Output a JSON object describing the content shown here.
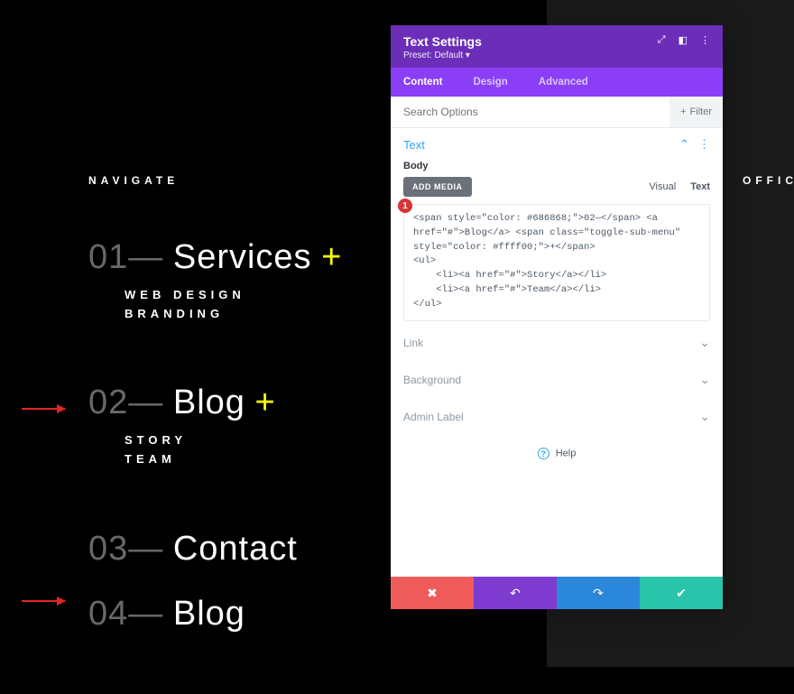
{
  "labels": {
    "navigate": "NAVIGATE",
    "office": "OFFICE"
  },
  "nav": [
    {
      "num": "01—",
      "title": "Services",
      "plus": "+",
      "sub": [
        "WEB DESIGN",
        "BRANDING"
      ]
    },
    {
      "num": "02—",
      "title": "Blog",
      "plus": "+",
      "sub": [
        "STORY",
        "TEAM"
      ]
    },
    {
      "num": "03—",
      "title": "Contact"
    },
    {
      "num": "04—",
      "title": "Blog"
    }
  ],
  "annotation": {
    "badge": "1"
  },
  "modal": {
    "title": "Text Settings",
    "preset": "Preset: Default ▾",
    "tabs": {
      "content": "Content",
      "design": "Design",
      "advanced": "Advanced"
    },
    "search_placeholder": "Search Options",
    "filter": "Filter",
    "section": "Text",
    "body_label": "Body",
    "add_media": "ADD MEDIA",
    "editor_tabs": {
      "visual": "Visual",
      "text": "Text"
    },
    "code": "<span style=\"color: #686868;\">02—</span> <a href=\"#\">Blog</a> <span class=\"toggle-sub-menu\" style=\"color: #ffff00;\">+</span>\n<ul>\n    <li><a href=\"#\">Story</a></li>\n    <li><a href=\"#\">Team</a></li>\n</ul>",
    "rows": {
      "link": "Link",
      "background": "Background",
      "admin_label": "Admin Label"
    },
    "help": "Help"
  }
}
